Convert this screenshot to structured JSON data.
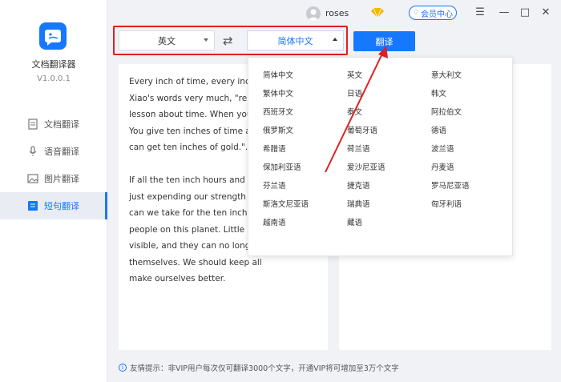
{
  "app": {
    "name": "文档翻译器",
    "version": "V1.0.0.1"
  },
  "sidebar": {
    "items": [
      {
        "label": "文档翻译",
        "icon": "document-icon"
      },
      {
        "label": "语音翻译",
        "icon": "microphone-icon"
      },
      {
        "label": "图片翻译",
        "icon": "image-icon"
      },
      {
        "label": "短句翻译",
        "icon": "sentence-icon"
      }
    ],
    "active": "短句翻译"
  },
  "topbar": {
    "username": "roses",
    "member_label": "会员中心",
    "minimize": "—",
    "maximize": "□",
    "close": "✕",
    "menu": "☰"
  },
  "toolbar": {
    "source_lang": "英文",
    "target_lang": "简体中文",
    "swap": "⇄",
    "translate_label": "翻译"
  },
  "source_text": "Every inch of time, every inch of\nXiao's words very much, \"remem\nlesson about time. When you g\nYou give ten inches of time and\ncan get ten inches of gold.\".\n\nIf all the ten inch hours and mi\njust expending our strength and\ncan we take for the ten inch go\npeople on this planet. Little peo\nvisible, and they can no longer\nthemselves. We should keep all\nmake ourselves better.",
  "languages": [
    "简体中文",
    "英文",
    "意大利文",
    "繁体中文",
    "日语",
    "韩文",
    "西班牙文",
    "泰文",
    "阿拉伯文",
    "俄罗斯文",
    "葡萄牙语",
    "德语",
    "希腊语",
    "荷兰语",
    "波兰语",
    "保加利亚语",
    "爱沙尼亚语",
    "丹麦语",
    "芬兰语",
    "捷克语",
    "罗马尼亚语",
    "斯洛文尼亚语",
    "瑞典语",
    "匈牙利语",
    "越南语",
    "藏语"
  ],
  "footer": {
    "tip": "友情提示：非VIP用户每次仅可翻译3000个文字，开通VIP将可增加至3万个文字"
  },
  "colors": {
    "accent": "#1677ff",
    "highlight": "#e02020"
  }
}
